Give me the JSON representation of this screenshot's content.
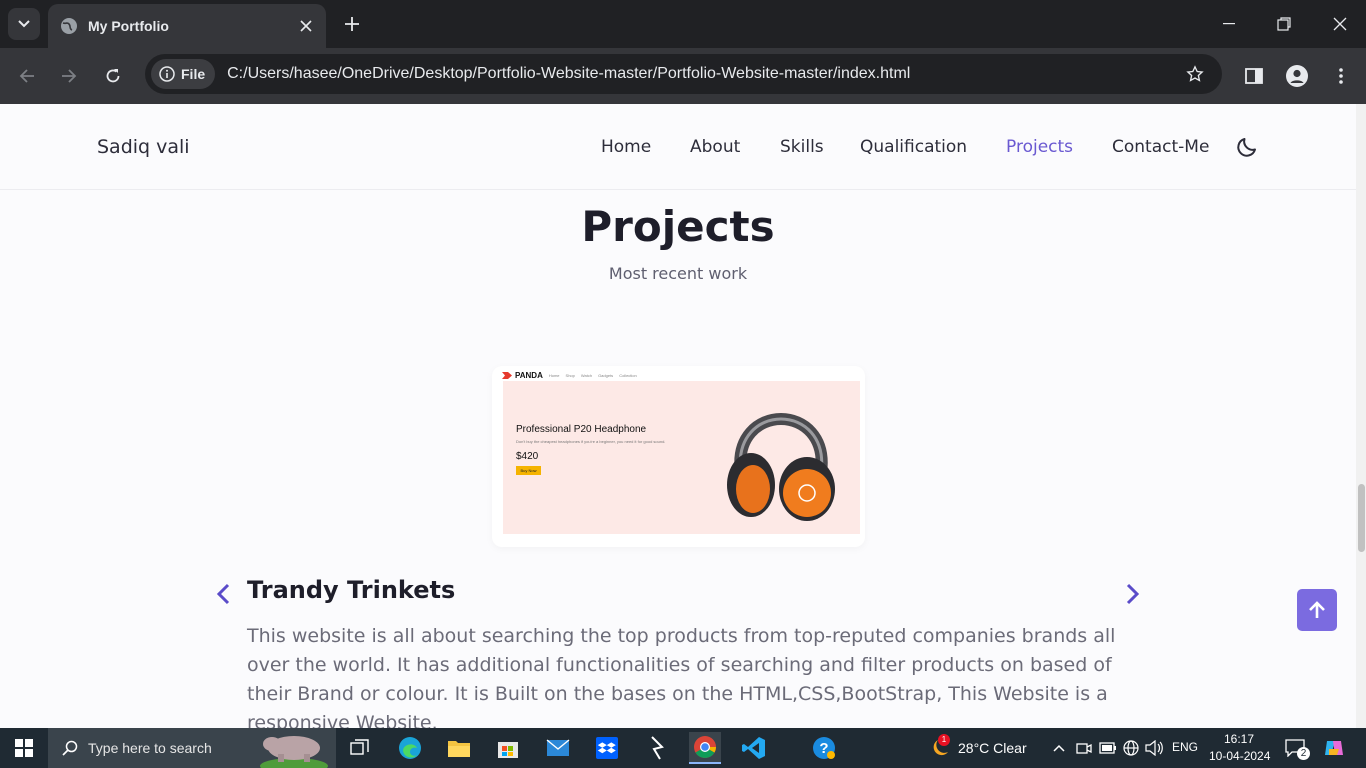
{
  "browser": {
    "tab_title": "My Portfolio",
    "chip_label": "File",
    "url": "C:/Users/hasee/OneDrive/Desktop/Portfolio-Website-master/Portfolio-Website-master/index.html"
  },
  "site": {
    "logo": "Sadiq vali",
    "nav": [
      "Home",
      "About",
      "Skills",
      "Qualification",
      "Projects",
      "Contact-Me"
    ],
    "active_nav": "Projects",
    "accent": "#6a59d1"
  },
  "section": {
    "title": "Projects",
    "subtitle": "Most recent work"
  },
  "project": {
    "screenshot": {
      "brand": "PANDA",
      "links": [
        "Home",
        "Shop",
        "Watch",
        "Gadgets",
        "Collection"
      ],
      "headline": "Professional P20 Headphone",
      "desc": "Don't buy the cheapest headphones if you're a beginner, you need it for good sound.",
      "price": "$420",
      "button": "Buy Now"
    },
    "title": "Trandy Trinkets",
    "description": "This website is all about searching the top products from top-reputed companies brands all over the world. It has additional functionalities of searching and filter products on based of their Brand or colour. It is Built on the bases on the HTML,CSS,BootStrap, This Website is a responsive Website."
  },
  "taskbar": {
    "search_placeholder": "Type here to search",
    "weather": "28°C  Clear",
    "language": "ENG",
    "time": "16:17",
    "date": "10-04-2024",
    "notifications": "2",
    "weather_badge": "1"
  }
}
